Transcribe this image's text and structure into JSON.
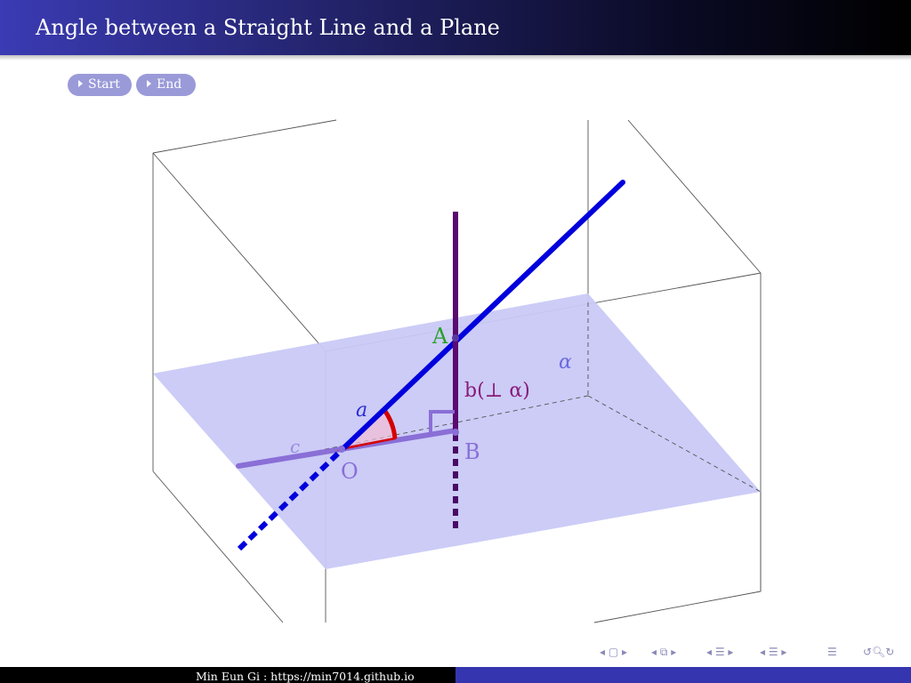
{
  "header": {
    "title": "Angle between a Straight Line and a Plane"
  },
  "buttons": {
    "start_label": "Start",
    "end_label": "End"
  },
  "figure": {
    "labels": {
      "point_a": "A",
      "point_b": "B",
      "point_o": "O",
      "line_a": "a",
      "line_b": "b(⊥ α)",
      "line_c": "c",
      "plane": "α"
    },
    "colors": {
      "plane": "#c9c9f7",
      "line_a": "#0000dd",
      "line_b": "#5a0a70",
      "line_c": "#8a6fd6",
      "angle": "#d40000",
      "label_a_point": "#2aa02a"
    }
  },
  "nav": {
    "icons": [
      "nav-frame-icon",
      "nav-section-icon",
      "nav-subsection-icon",
      "nav-align-icon",
      "nav-search-icon"
    ]
  },
  "footer": {
    "author": "Min Eun Gi : https://min7014.github.io"
  }
}
